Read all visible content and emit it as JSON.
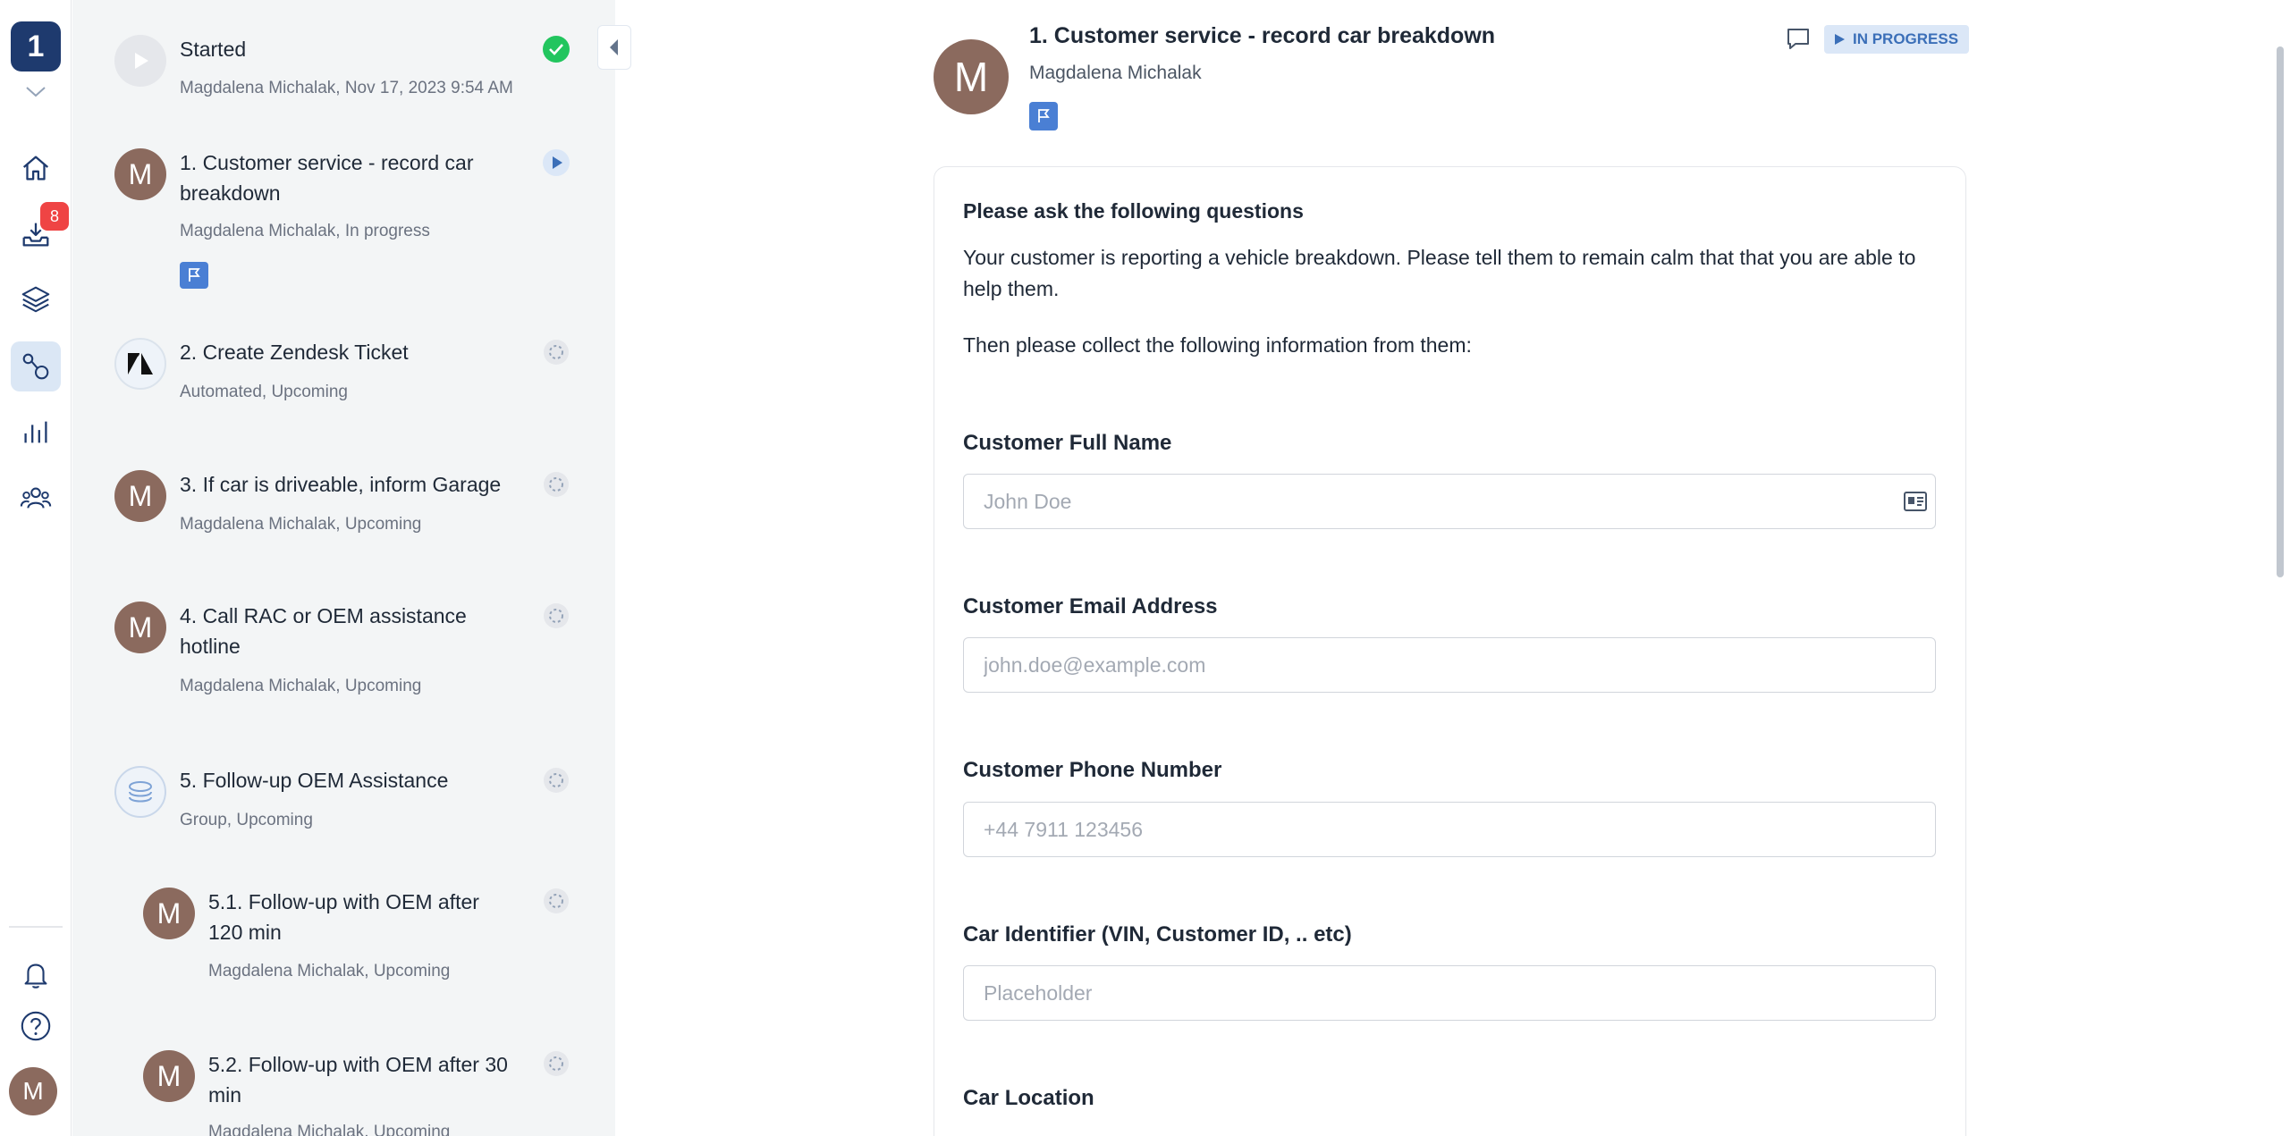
{
  "rail": {
    "workspace_badge": "1",
    "inbox_count": "8",
    "avatar_initial": "M",
    "icons": [
      "home-icon",
      "inbox-icon",
      "layers-icon",
      "workflow-icon",
      "analytics-icon",
      "team-icon",
      "bell-icon",
      "help-icon"
    ]
  },
  "steps": [
    {
      "title": "Started",
      "meta": "Magdalena Michalak, Nov 17, 2023 9:54 AM",
      "status": "done"
    },
    {
      "title": "1.  Customer service - record car breakdown",
      "meta": "Magdalena Michalak, In progress",
      "status": "in-progress",
      "avatar": "M"
    },
    {
      "title": "2.  Create Zendesk Ticket",
      "meta": "Automated, Upcoming",
      "status": "upcoming"
    },
    {
      "title": "3.  If car is driveable, inform Garage",
      "meta": "Magdalena Michalak, Upcoming",
      "status": "upcoming",
      "avatar": "M"
    },
    {
      "title": "4.  Call RAC or OEM assistance hotline",
      "meta": "Magdalena Michalak, Upcoming",
      "status": "upcoming",
      "avatar": "M"
    },
    {
      "title": "5.  Follow-up OEM Assistance",
      "meta": "Group, Upcoming",
      "status": "upcoming"
    },
    {
      "title": "5.1.  Follow-up with OEM after 120 min",
      "meta": "Magdalena Michalak, Upcoming",
      "status": "upcoming",
      "avatar": "M"
    },
    {
      "title": "5.2.  Follow-up with OEM after 30 min",
      "meta": "Magdalena Michalak, Upcoming",
      "status": "upcoming",
      "avatar": "M"
    }
  ],
  "task": {
    "avatar": "M",
    "title": "1. Customer service - record car breakdown",
    "assignee": "Magdalena Michalak",
    "status": "IN PROGRESS"
  },
  "form": {
    "heading": "Please ask the following questions",
    "intro": "Your customer is reporting a vehicle breakdown. Please tell them to remain calm that that you are able to help them.",
    "instruction": "Then please collect the following information from them:",
    "fields": [
      {
        "label": "Customer Full Name",
        "placeholder": "John Doe",
        "value": ""
      },
      {
        "label": "Customer Email Address",
        "placeholder": "john.doe@example.com",
        "value": ""
      },
      {
        "label": "Customer Phone Number",
        "placeholder": "+44 7911 123456",
        "value": ""
      },
      {
        "label": "Car Identifier (VIN, Customer ID, .. etc)",
        "placeholder": "Placeholder",
        "value": ""
      },
      {
        "label": "Car Location"
      }
    ]
  },
  "colors": {
    "brand": "#1e3a6e",
    "accent": "#4a7fd4",
    "success": "#22c55e",
    "danger": "#ef4444"
  }
}
